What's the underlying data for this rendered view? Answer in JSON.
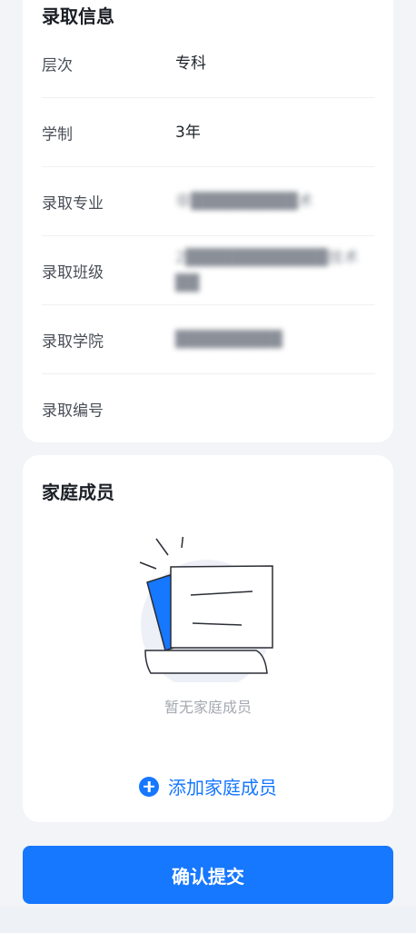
{
  "admission": {
    "title": "录取信息",
    "rows": [
      {
        "label": "层次",
        "value": "专科"
      },
      {
        "label": "学制",
        "value": "3年"
      },
      {
        "label": "录取专业",
        "value": "非█████████术"
      },
      {
        "label": "录取班级",
        "value": "2████████████技术██"
      },
      {
        "label": "录取学院",
        "value": "█████████"
      },
      {
        "label": "录取编号",
        "value": ""
      }
    ]
  },
  "family": {
    "title": "家庭成员",
    "empty_text": "暂无家庭成员",
    "add_label": "添加家庭成员"
  },
  "submit_label": "确认提交",
  "colors": {
    "accent": "#1677ff",
    "background": "#f2f4f7",
    "card": "#ffffff"
  }
}
